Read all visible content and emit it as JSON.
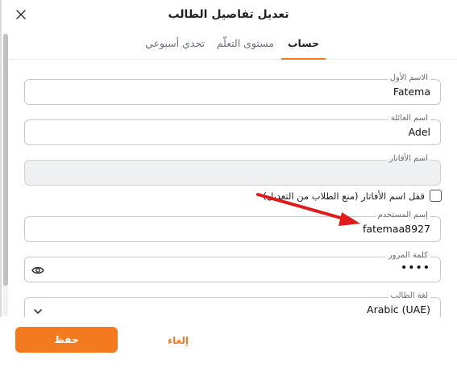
{
  "dialog": {
    "title": "تعديل تفاصيل الطالب"
  },
  "tabs": [
    {
      "label": "حساب",
      "active": true
    },
    {
      "label": "مستوى التعلّم",
      "active": false
    },
    {
      "label": "تحدي أسبوعي",
      "active": false
    }
  ],
  "form": {
    "first_name": {
      "label": "الاسم الأول",
      "value": "Fatema"
    },
    "last_name": {
      "label": "اسم العائلة",
      "value": "Adel"
    },
    "avatar_name": {
      "label": "اسم الأفاتار",
      "value": ""
    },
    "lock_avatar": {
      "label": "قفل اسم الأفاتار (منع الطلاب من التعديل)",
      "checked": false
    },
    "username": {
      "label": "إسم المستخدم",
      "value": "fatemaa8927"
    },
    "password": {
      "label": "كلمة المرور",
      "value": "••••"
    },
    "student_language": {
      "label": "لغة الطالب",
      "value": "Arabic (UAE)"
    }
  },
  "footer": {
    "save_label": "حفظ",
    "cancel_label": "إلغاء"
  },
  "colors": {
    "accent": "#f47a20",
    "annotation_arrow": "#e01b1b"
  },
  "icons": {
    "close": "close-icon",
    "password_toggle": "eye-icon",
    "dropdown": "chevron-down-icon"
  }
}
